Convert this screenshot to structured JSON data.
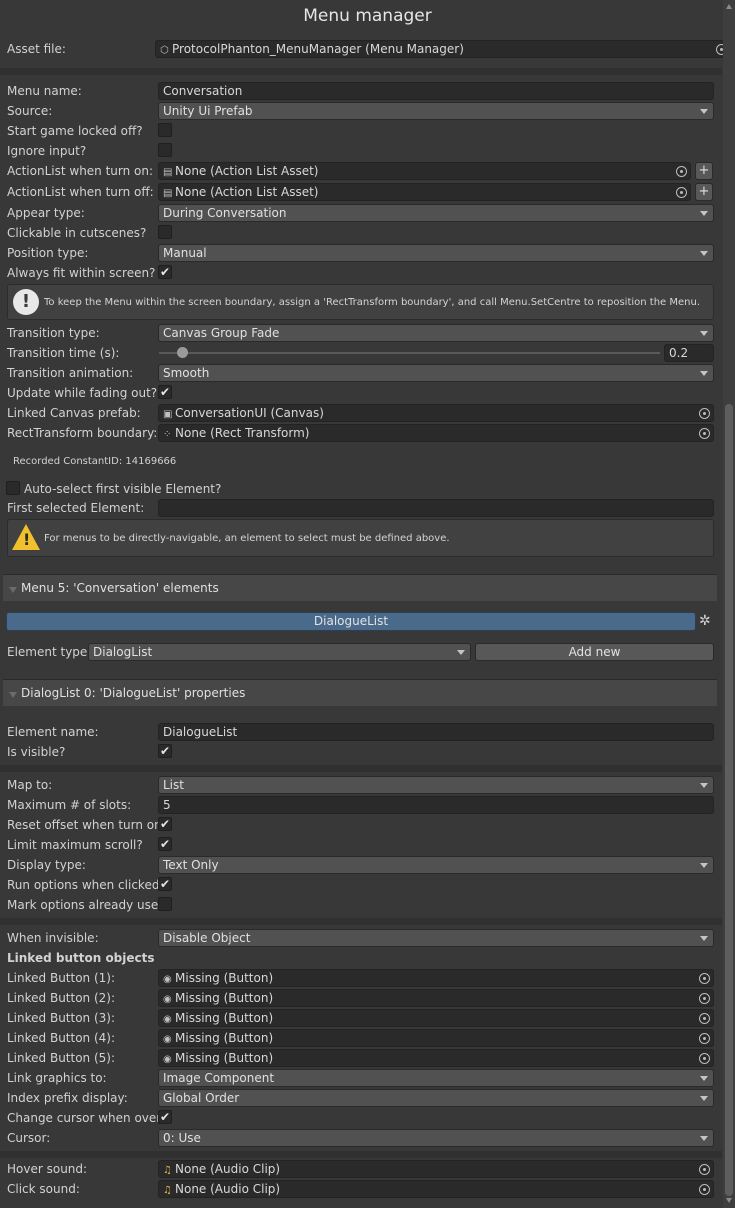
{
  "title": "Menu manager",
  "asset_file": {
    "label": "Asset file:",
    "value": "ProtocolPhanton_MenuManager (Menu Manager)",
    "icon": "cube-icon"
  },
  "menu": {
    "name_label": "Menu name:",
    "name_value": "Conversation",
    "source_label": "Source:",
    "source_value": "Unity Ui Prefab",
    "start_locked_label": "Start game locked off?",
    "start_locked": false,
    "ignore_input_label": "Ignore input?",
    "ignore_input": false,
    "al_on_label": "ActionList when turn on:",
    "al_on_value": "None (Action List Asset)",
    "al_off_label": "ActionList when turn off:",
    "al_off_value": "None (Action List Asset)",
    "plus": "+",
    "appear_label": "Appear type:",
    "appear_value": "During Conversation",
    "clickable_label": "Clickable in cutscenes?",
    "clickable": false,
    "position_label": "Position type:",
    "position_value": "Manual",
    "fit_label": "Always fit within screen?",
    "fit": true,
    "info_icon": "!",
    "info_text": "To keep the Menu within the screen boundary, assign a 'RectTransform boundary', and call Menu.SetCentre to reposition the Menu.",
    "transition_label": "Transition type:",
    "transition_value": "Canvas Group Fade",
    "time_label": "Transition time (s):",
    "time_value": "0.2",
    "time_fraction": 0.04,
    "anim_label": "Transition animation:",
    "anim_value": "Smooth",
    "update_fade_label": "Update while fading out?",
    "update_fade": true,
    "canvas_label": "Linked Canvas prefab:",
    "canvas_value": "ConversationUI (Canvas)",
    "rect_label": "RectTransform boundary:",
    "rect_value": "None (Rect Transform)",
    "constant_id": "Recorded ConstantID: 14169666",
    "auto_select_label": "Auto-select first visible Element?",
    "auto_select": false,
    "first_selected_label": "First selected Element:",
    "first_selected_value": "",
    "warn_icon": "!",
    "warn_text": "For menus to be directly-navigable, an element to select must be defined above."
  },
  "elements": {
    "header": "Menu 5: 'Conversation' elements",
    "selected": "DialogueList",
    "type_label": "Element type:",
    "type_value": "DialogList",
    "add_new": "Add new"
  },
  "props": {
    "header": "DialogList 0: 'DialogueList' properties",
    "name_label": "Element name:",
    "name_value": "DialogueList",
    "visible_label": "Is visible?",
    "visible": true,
    "map_label": "Map to:",
    "map_value": "List",
    "max_slots_label": "Maximum # of slots:",
    "max_slots_value": "5",
    "reset_label": "Reset offset when turn on?",
    "reset": true,
    "limit_label": "Limit maximum scroll?",
    "limit": true,
    "display_label": "Display type:",
    "display_value": "Text Only",
    "run_label": "Run options when clicked?",
    "run": true,
    "mark_label": "Mark options already used",
    "mark": false,
    "invisible_label": "When invisible:",
    "invisible_value": "Disable Object",
    "linked_header": "Linked button objects",
    "buttons": [
      {
        "label": "Linked Button (1):",
        "value": "Missing (Button)"
      },
      {
        "label": "Linked Button (2):",
        "value": "Missing (Button)"
      },
      {
        "label": "Linked Button (3):",
        "value": "Missing (Button)"
      },
      {
        "label": "Linked Button (4):",
        "value": "Missing (Button)"
      },
      {
        "label": "Linked Button (5):",
        "value": "Missing (Button)"
      }
    ],
    "graphics_label": "Link graphics to:",
    "graphics_value": "Image Component",
    "prefix_label": "Index prefix display:",
    "prefix_value": "Global Order",
    "cursor_over_label": "Change cursor when over?",
    "cursor_over": true,
    "cursor_label": "Cursor:",
    "cursor_value": "0: Use",
    "hover_label": "Hover sound:",
    "hover_value": "None (Audio Clip)",
    "click_label": "Click sound:",
    "click_value": "None (Audio Clip)"
  },
  "check_glyph": "✔",
  "colors": {
    "background": "#383838",
    "selected_element": "#4a6a8c",
    "warning": "#f0c12c"
  }
}
